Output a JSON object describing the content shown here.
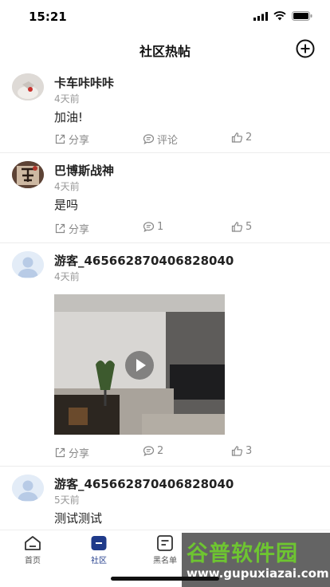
{
  "status_bar": {
    "time": "15:21"
  },
  "header": {
    "title": "社区热帖"
  },
  "posts": [
    {
      "author": "卡车咔咔咔",
      "time": "4天前",
      "content": "加油!",
      "share_label": "分享",
      "comment_label": "评论",
      "like_count": "2"
    },
    {
      "author": "巴博斯战神",
      "time": "4天前",
      "content": "是吗",
      "share_label": "分享",
      "comment_label": "1",
      "like_count": "5"
    },
    {
      "author": "游客_465662870406828040",
      "time": "4天前",
      "content": "",
      "share_label": "分享",
      "comment_label": "2",
      "like_count": "3"
    },
    {
      "author": "游客_465662870406828040",
      "time": "5天前",
      "content": "测试测试"
    }
  ],
  "tabs": [
    {
      "label": "首页",
      "icon": "home-icon"
    },
    {
      "label": "社区",
      "icon": "community-icon",
      "active": true
    },
    {
      "label": "黑名单",
      "icon": "blacklist-icon"
    }
  ],
  "watermark": {
    "text": "谷普软件园",
    "url": "www.gupuxiazai.com"
  },
  "colors": {
    "accent": "#1f3a8a",
    "muted": "#888888",
    "watermark_green": "#6ec531"
  }
}
